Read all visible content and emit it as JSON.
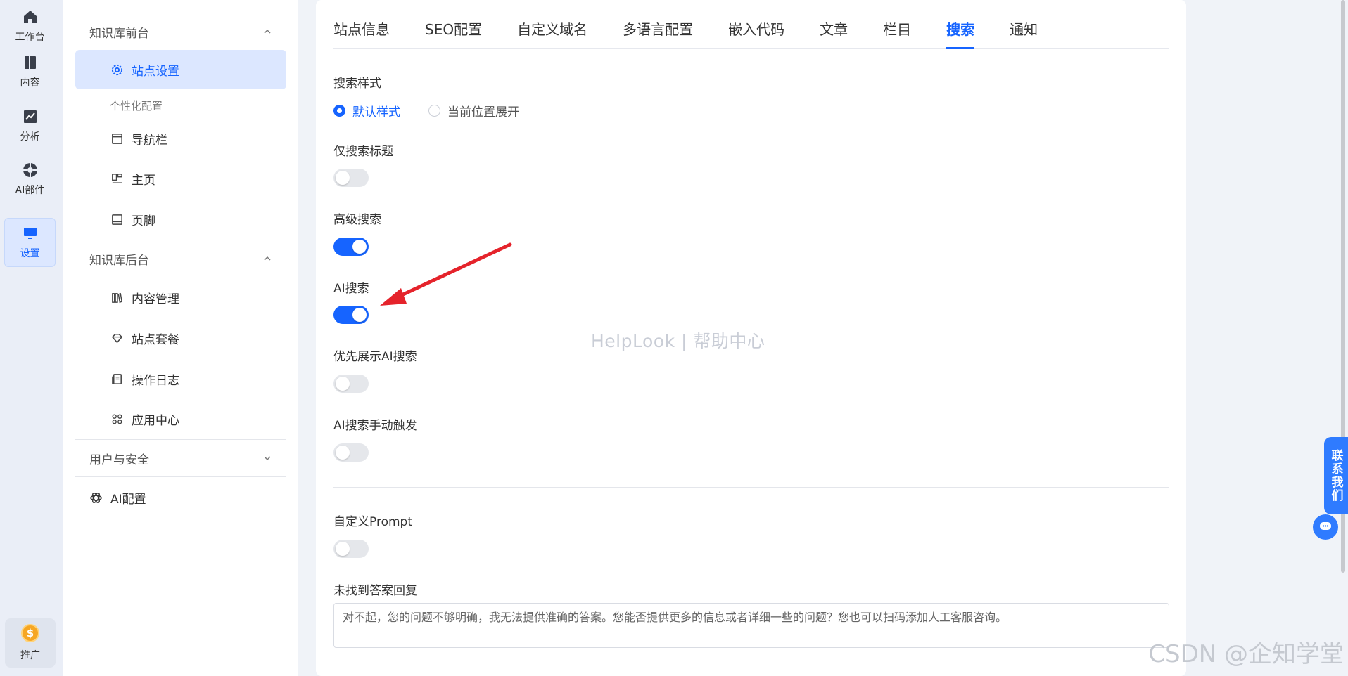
{
  "rail": {
    "items": [
      {
        "label": "工作台",
        "icon": "home-icon"
      },
      {
        "label": "内容",
        "icon": "book-icon"
      },
      {
        "label": "分析",
        "icon": "chart-icon"
      },
      {
        "label": "AI部件",
        "icon": "ai-widget-icon"
      },
      {
        "label": "设置",
        "icon": "monitor-icon",
        "active": true
      }
    ],
    "promo_label": "推广",
    "promo_coin": "$"
  },
  "sidebar": {
    "group1_title": "知识库前台",
    "site_settings": "站点设置",
    "personalize_label": "个性化配置",
    "navbar": "导航栏",
    "homepage": "主页",
    "footer": "页脚",
    "group2_title": "知识库后台",
    "content_mgmt": "内容管理",
    "site_plan": "站点套餐",
    "op_log": "操作日志",
    "app_center": "应用中心",
    "group3_title": "用户与安全",
    "ai_config": "AI配置"
  },
  "tabs": [
    "站点信息",
    "SEO配置",
    "自定义域名",
    "多语言配置",
    "嵌入代码",
    "文章",
    "栏目",
    "搜索",
    "通知"
  ],
  "active_tab": "搜索",
  "form": {
    "search_style_label": "搜索样式",
    "radio_default": "默认样式",
    "radio_expand": "当前位置展开",
    "title_only_label": "仅搜索标题",
    "title_only_on": false,
    "advanced_label": "高级搜索",
    "advanced_on": true,
    "ai_search_label": "AI搜索",
    "ai_search_on": true,
    "prefer_ai_label": "优先展示AI搜索",
    "prefer_ai_on": false,
    "ai_manual_label": "AI搜索手动触发",
    "ai_manual_on": false,
    "custom_prompt_label": "自定义Prompt",
    "custom_prompt_on": false,
    "no_answer_label": "未找到答案回复",
    "no_answer_text": "对不起，您的问题不够明确，我无法提供准确的答案。您能否提供更多的信息或者详细一些的问题？您也可以扫码添加人工客服咨询。"
  },
  "watermark": "HelpLook | 帮助中心",
  "csdn_watermark": "CSDN @企知学堂",
  "contact_label": "联系我们",
  "colors": {
    "accent": "#1664ff",
    "arrow": "#e5232b"
  }
}
